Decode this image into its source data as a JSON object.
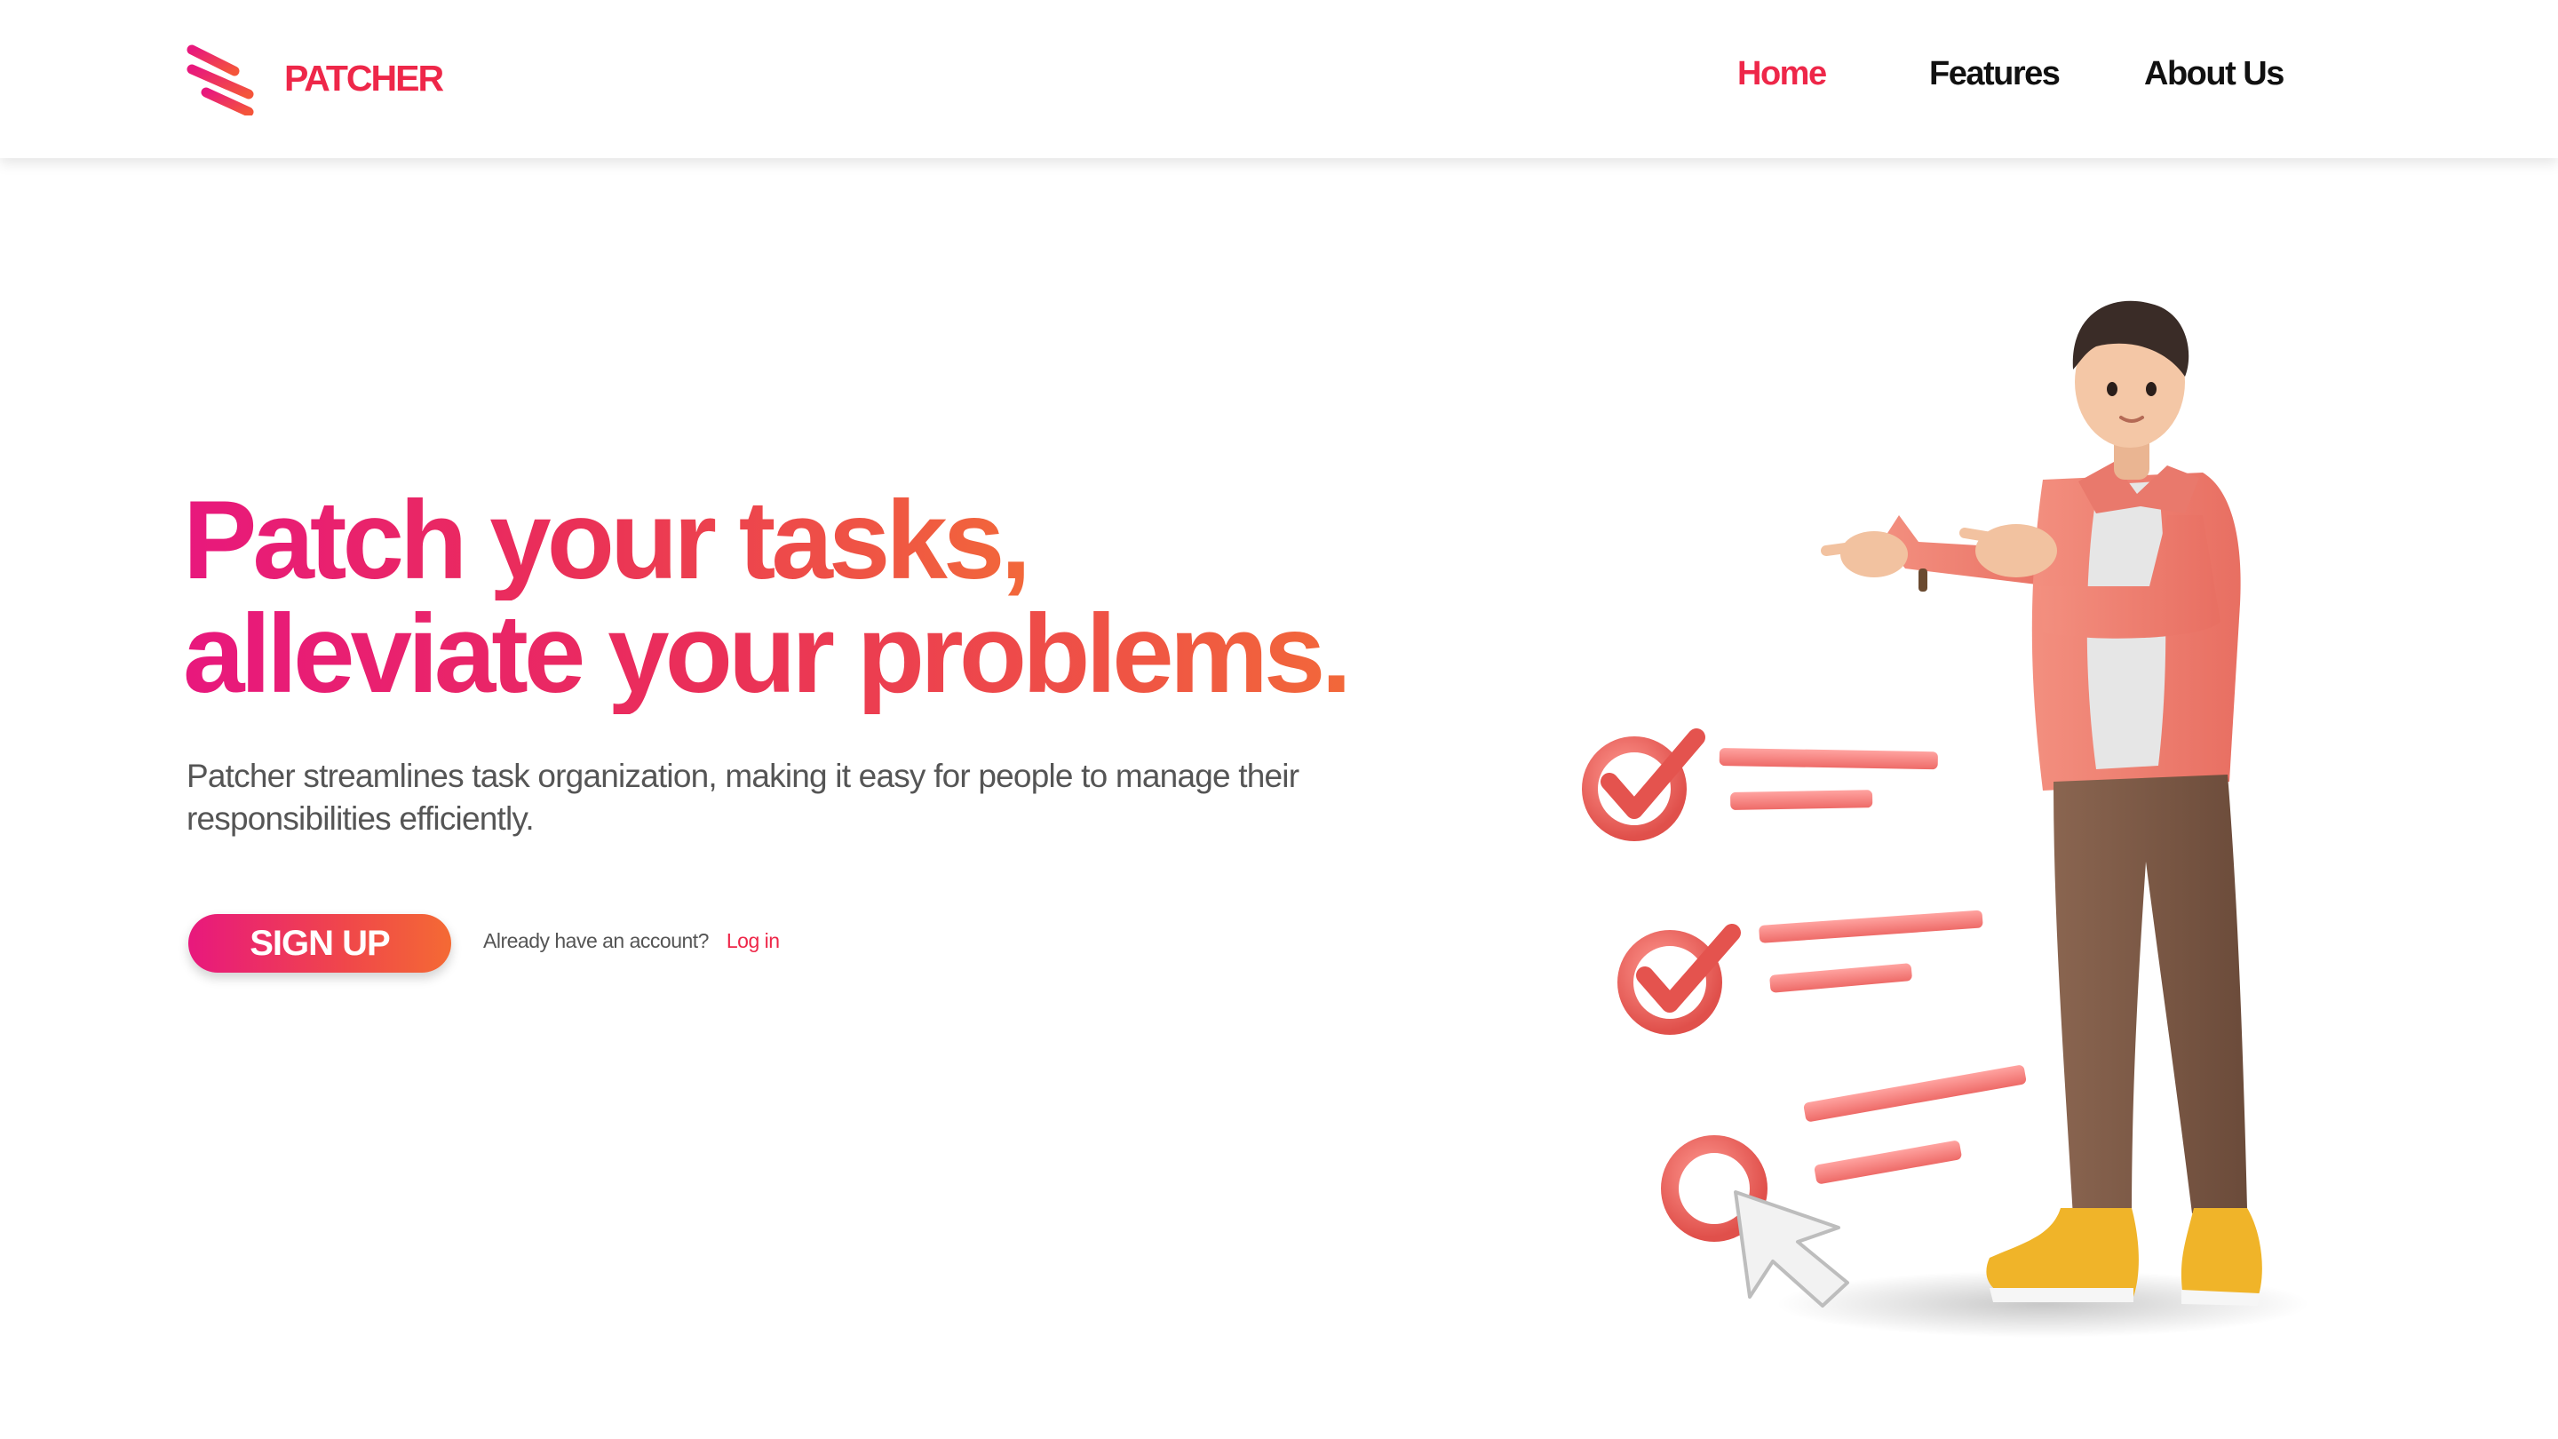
{
  "brand": {
    "name": "PATCHER",
    "logo_icon": "stripes-logo-icon"
  },
  "nav": {
    "items": [
      {
        "label": "Home",
        "active": true
      },
      {
        "label": "Features",
        "active": false
      },
      {
        "label": "About Us",
        "active": false
      }
    ]
  },
  "hero": {
    "headline_line1": "Patch your tasks,",
    "headline_line2": "alleviate your problems.",
    "description": "Patcher streamlines task organization, making it easy for people to manage their responsibilities efficiently.",
    "signup_label": "SIGN UP",
    "account_prompt": "Already have an account?",
    "login_label": "Log in"
  },
  "illustration": {
    "subject": "3d-man-pointing-at-checklist",
    "icons": [
      "check-circle-icon",
      "check-circle-icon",
      "empty-circle-icon",
      "mouse-cursor-icon"
    ]
  },
  "colors": {
    "accent": "#ee2749",
    "gradient_start": "#e8187d",
    "gradient_end": "#f46a34",
    "text_dark": "#111111",
    "text_muted": "#555555"
  }
}
